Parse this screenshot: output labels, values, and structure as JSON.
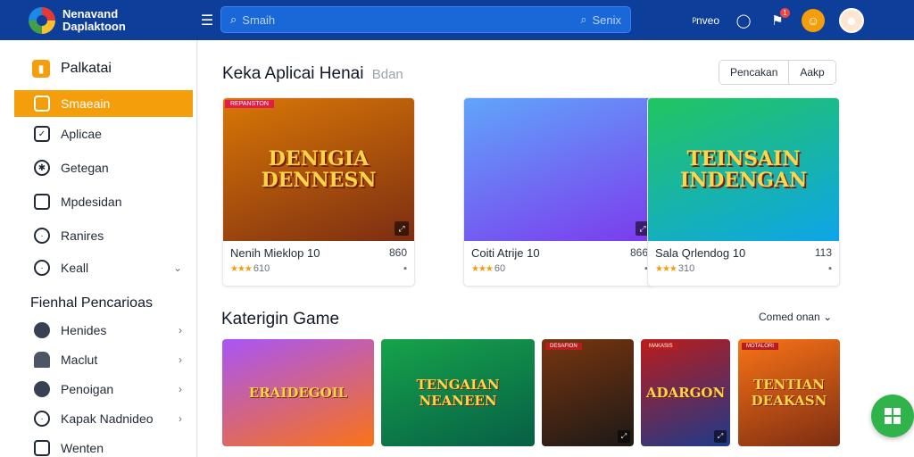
{
  "app": {
    "name_line1": "Nenavand",
    "name_line2": "Daplaktoon",
    "menu_icon": "hamburger-icon"
  },
  "search": {
    "placeholder": "Smaih",
    "right_label": "Senix",
    "icon": "search-icon"
  },
  "topbar": {
    "link_label": "ᵖnveo",
    "notification_count": "1"
  },
  "sidebar": {
    "header": "Palkatai",
    "items": [
      {
        "label": "Smaeain",
        "icon": "square-icon",
        "active": true
      },
      {
        "label": "Aplicae",
        "icon": "checkbox-icon"
      },
      {
        "label": "Getegan",
        "icon": "gear-icon"
      },
      {
        "label": "Mpdesidan",
        "icon": "square-icon"
      },
      {
        "label": "Ranires",
        "icon": "clock-icon"
      },
      {
        "label": "Keall",
        "icon": "clock-icon"
      }
    ],
    "section_title": "Fienhal Pencarioas",
    "section_items": [
      {
        "label": "Henides",
        "icon": "controller-icon"
      },
      {
        "label": "Maclut",
        "icon": "puzzle-icon"
      },
      {
        "label": "Penoigan",
        "icon": "circle-icon"
      },
      {
        "label": "Kapak Nadnideo",
        "icon": "clock-icon"
      },
      {
        "label": "Wenten",
        "icon": "square-icon"
      }
    ]
  },
  "featured": {
    "title": "Keka Aplicai Henai",
    "subtitle": "Bdan",
    "buttons": [
      "Pencakan",
      "Aakp"
    ],
    "cards": [
      {
        "art_title": "DENIGIA DENNESN",
        "tag": "REPANSTON",
        "name": "Nenih Mieklop 10",
        "count": "860",
        "rating": "610",
        "stars": 3,
        "colors": [
          "#d97706",
          "#7c2d12"
        ]
      },
      {
        "art_title": "",
        "tag": "",
        "name": "Coiti Atrije 10",
        "count": "866",
        "rating": "60",
        "stars": 3,
        "colors": [
          "#60a5fa",
          "#7c3aed"
        ]
      },
      {
        "art_title": "TEINSAIN INDENGAN",
        "tag": "",
        "name": "Sala Qrlendog 10",
        "count": "113",
        "rating": "310",
        "stars": 3,
        "colors": [
          "#22c55e",
          "#0ea5e9"
        ]
      }
    ]
  },
  "categories": {
    "title": "Katerigin Game",
    "sort_label": "Comed onan",
    "tiles": [
      {
        "art_title": "ERAIDEGOIL",
        "tag": "",
        "colors": [
          "#a855f7",
          "#f97316"
        ]
      },
      {
        "art_title": "TENGAIAN NEANEEN",
        "tag": "",
        "colors": [
          "#16a34a",
          "#065f46"
        ]
      },
      {
        "art_title": "",
        "tag": "DESAFION",
        "colors": [
          "#78350f",
          "#1c1917"
        ]
      },
      {
        "art_title": "ADARGON",
        "tag": "MAKASIS",
        "colors": [
          "#b91c1c",
          "#1e3a8a"
        ]
      },
      {
        "art_title": "TENTIAN DEAKASN",
        "tag": "MOTALORI",
        "colors": [
          "#f97316",
          "#7c2d12"
        ]
      }
    ]
  },
  "fab": {
    "icon": "grid-icon"
  }
}
